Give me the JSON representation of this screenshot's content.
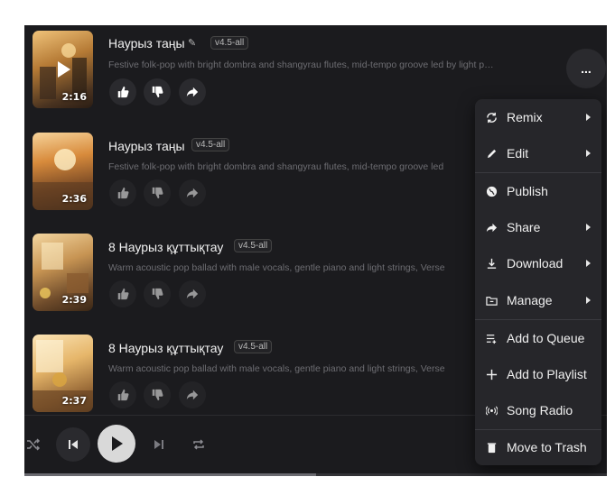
{
  "songs": [
    {
      "title": "Наурыз таңы",
      "version": "v4.5-all",
      "description": "Festive folk-pop with bright dombra and shangyrau flutes, mid-tempo groove led by light perc...",
      "duration": "2:16",
      "editable": true
    },
    {
      "title": "Наурыз таңы",
      "version": "v4.5-all",
      "description": "Festive folk-pop with bright dombra and shangyrau flutes, mid-tempo groove led",
      "duration": "2:36"
    },
    {
      "title": "8 Наурыз құттықтау",
      "version": "v4.5-all",
      "description": "Warm acoustic pop ballad with male vocals, gentle piano and light strings, Verse",
      "duration": "2:39"
    },
    {
      "title": "8 Наурыз құттықтау",
      "version": "v4.5-all",
      "description": "Warm acoustic pop ballad with male vocals, gentle piano and light strings, Verse",
      "duration": "2:37"
    }
  ],
  "more_label": "...",
  "menu": {
    "items": [
      {
        "label": "Remix",
        "icon": "remix-icon",
        "submenu": true
      },
      {
        "label": "Edit",
        "icon": "pencil-icon",
        "submenu": true
      },
      {
        "label": "Publish",
        "icon": "globe-icon",
        "submenu": false
      },
      {
        "label": "Share",
        "icon": "share-icon",
        "submenu": true
      },
      {
        "label": "Download",
        "icon": "download-icon",
        "submenu": true
      },
      {
        "label": "Manage",
        "icon": "folder-icon",
        "submenu": true
      },
      {
        "label": "Add to Queue",
        "icon": "queue-icon",
        "submenu": false
      },
      {
        "label": "Add to Playlist",
        "icon": "plus-icon",
        "submenu": false
      },
      {
        "label": "Song Radio",
        "icon": "radio-icon",
        "submenu": false
      },
      {
        "label": "Move to Trash",
        "icon": "trash-icon",
        "submenu": false
      }
    ]
  },
  "player": {
    "progress": 0.5
  },
  "colors": {
    "background": "#1b1b1e",
    "menu": "#26262a",
    "text": "#f0f0f0",
    "muted": "#6d6d72"
  }
}
